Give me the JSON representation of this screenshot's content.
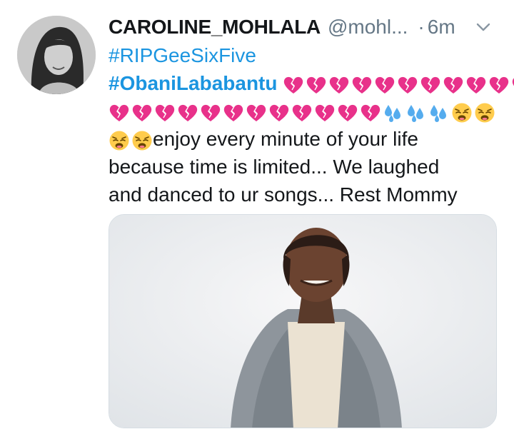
{
  "tweet": {
    "display_name": "CAROLINE_MOHLALA",
    "handle": "@mohl...",
    "separator": "·",
    "time": "6m",
    "hashtag_1": "#RIPGeeSixFive",
    "hashtag_2": "#ObaniLababantu",
    "text_line_1": "enjoy every minute of your life",
    "text_line_2": "because time is limited... We laughed",
    "text_line_3": "and danced to ur songs... Rest Mommy",
    "emojis": {
      "line2": [
        "broken-heart",
        "broken-heart",
        "broken-heart",
        "broken-heart",
        "broken-heart",
        "broken-heart",
        "broken-heart",
        "broken-heart",
        "broken-heart",
        "broken-heart",
        "broken-heart"
      ],
      "line3": [
        "broken-heart",
        "broken-heart",
        "broken-heart",
        "broken-heart",
        "broken-heart",
        "broken-heart",
        "broken-heart",
        "broken-heart",
        "broken-heart",
        "broken-heart",
        "broken-heart",
        "broken-heart",
        "sweat-droplets",
        "sweat-droplets",
        "sweat-droplets",
        "weary-face",
        "weary-face"
      ],
      "line4": [
        "weary-face",
        "weary-face"
      ]
    },
    "colors": {
      "link": "#1b95e0",
      "secondary": "#657786",
      "heart": "#e8318a"
    },
    "icons": {
      "menu": "chevron-down-icon",
      "avatar": "profile-photo",
      "media": "photo-woman-in-grey-blazer"
    }
  }
}
